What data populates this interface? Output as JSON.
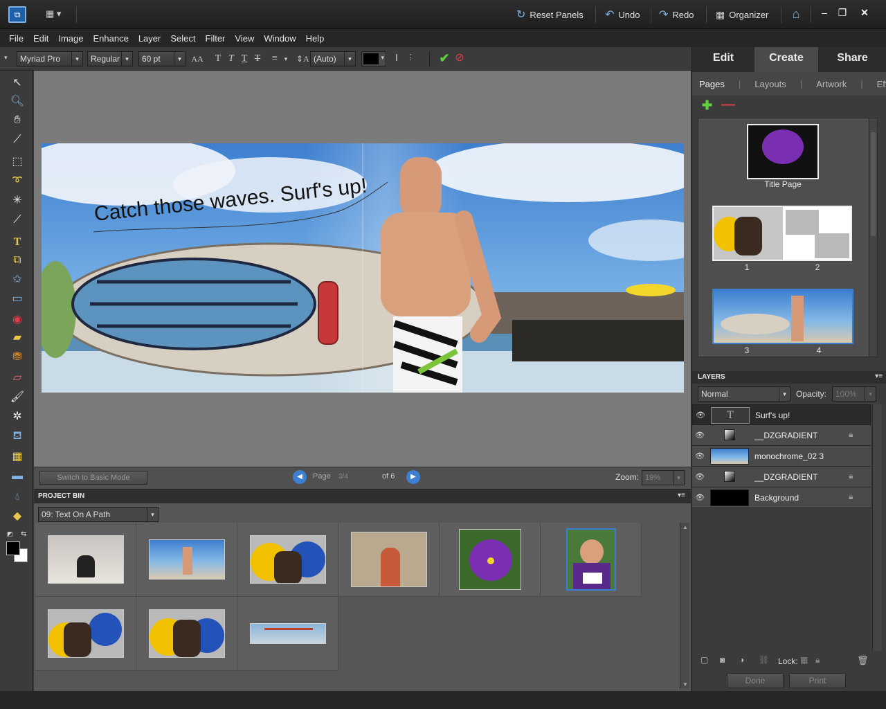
{
  "app": {
    "logo": "pse-logo-icon"
  },
  "titlebar": {
    "reset_panels": "Reset Panels",
    "undo": "Undo",
    "redo": "Redo",
    "organizer": "Organizer"
  },
  "menu": [
    "File",
    "Edit",
    "Image",
    "Enhance",
    "Layer",
    "Select",
    "Filter",
    "View",
    "Window",
    "Help"
  ],
  "options": {
    "font_family": "Myriad Pro",
    "font_style": "Regular",
    "font_size": "60 pt",
    "leading": "(Auto)",
    "text_color": "#000000"
  },
  "canvas": {
    "text_on_path": "Catch those waves. Surf's up!",
    "switch_mode": "Switch to Basic Mode",
    "page_label": "Page",
    "page_value": "3/4",
    "page_of": "of 6",
    "zoom_label": "Zoom:",
    "zoom_value": "19%"
  },
  "project_bin": {
    "title": "PROJECT BIN",
    "selector": "09: Text On A Path"
  },
  "panel": {
    "tabs": [
      "Edit",
      "Create",
      "Share"
    ],
    "active_tab": "Create",
    "subtabs": [
      "Pages",
      "Layouts",
      "Artwork",
      "Effects"
    ],
    "active_subtab": "Pages",
    "pages": [
      {
        "label": "Title Page"
      },
      {
        "left": "1",
        "right": "2"
      },
      {
        "left": "3",
        "right": "4"
      }
    ],
    "title_page_caption": "Title Page"
  },
  "layers": {
    "title": "LAYERS",
    "blend_mode": "Normal",
    "opacity_label": "Opacity:",
    "opacity_value": "100%",
    "items": [
      {
        "name": "Surf's up!",
        "locked": false,
        "type": "text"
      },
      {
        "name": "__DZGRADIENT",
        "locked": true,
        "type": "gradient"
      },
      {
        "name": "monochrome_02 3",
        "locked": false,
        "type": "photo"
      },
      {
        "name": "__DZGRADIENT",
        "locked": true,
        "type": "gradient"
      },
      {
        "name": "Background",
        "locked": true,
        "type": "background"
      }
    ],
    "lock_label": "Lock:"
  },
  "buttons": {
    "done": "Done",
    "print": "Print"
  },
  "colors": {
    "accent_blue": "#3b7fd0",
    "panel_bg": "#3b3b3b",
    "canvas_bg": "#7b7b7b"
  }
}
